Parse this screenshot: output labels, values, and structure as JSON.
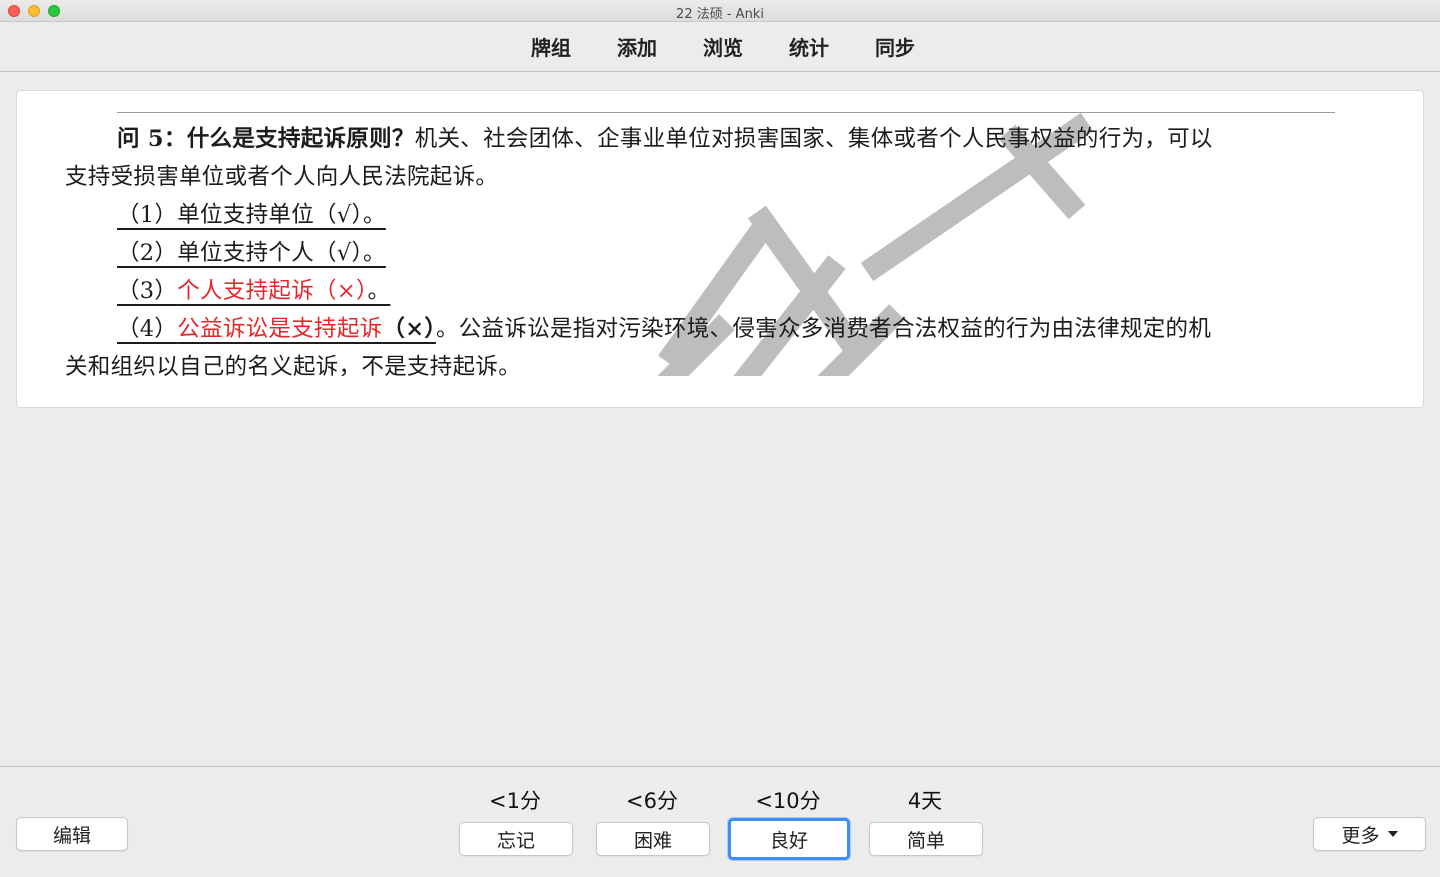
{
  "window": {
    "title": "22 法硕 - Anki"
  },
  "toolbar": {
    "items": [
      {
        "label": "牌组"
      },
      {
        "label": "添加"
      },
      {
        "label": "浏览"
      },
      {
        "label": "统计"
      },
      {
        "label": "同步"
      }
    ]
  },
  "card": {
    "question_label": "问 5：什么是支持起诉原则？",
    "question_text_1": "机关、社会团体、企事业单位对损害国家、集体或者个人民事权益的行为，可以",
    "question_text_2": "支持受损害单位或者个人向人民法院起诉。",
    "item1": "（1）单位支持单位（√）。",
    "item2": "（2）单位支持个人（√）。",
    "item3_prefix": "（3）",
    "item3_red": "个人支持起诉（×）",
    "item3_suffix": "。",
    "item4_prefix": "（4）",
    "item4_red": "公益诉讼是支持起诉",
    "item4_mark": "（×）",
    "item4_rest": "。公益诉讼是指对污染环境、侵害众多消费者合法权益的行为由法律规定的机",
    "item4_cont": "关和组织以自己的名义起诉，不是支持起诉。",
    "watermark_icon": "watermark-stamp"
  },
  "answer_bar": {
    "edit_label": "编辑",
    "more_label": "更多",
    "buttons": [
      {
        "interval": "<1分",
        "label": "忘记"
      },
      {
        "interval": "<6分",
        "label": "困难"
      },
      {
        "interval": "<10分",
        "label": "良好"
      },
      {
        "interval": "4天",
        "label": "简单"
      }
    ]
  },
  "colors": {
    "focus_ring": "#3d8ff5",
    "wrong_answer_red": "#e8262a"
  }
}
